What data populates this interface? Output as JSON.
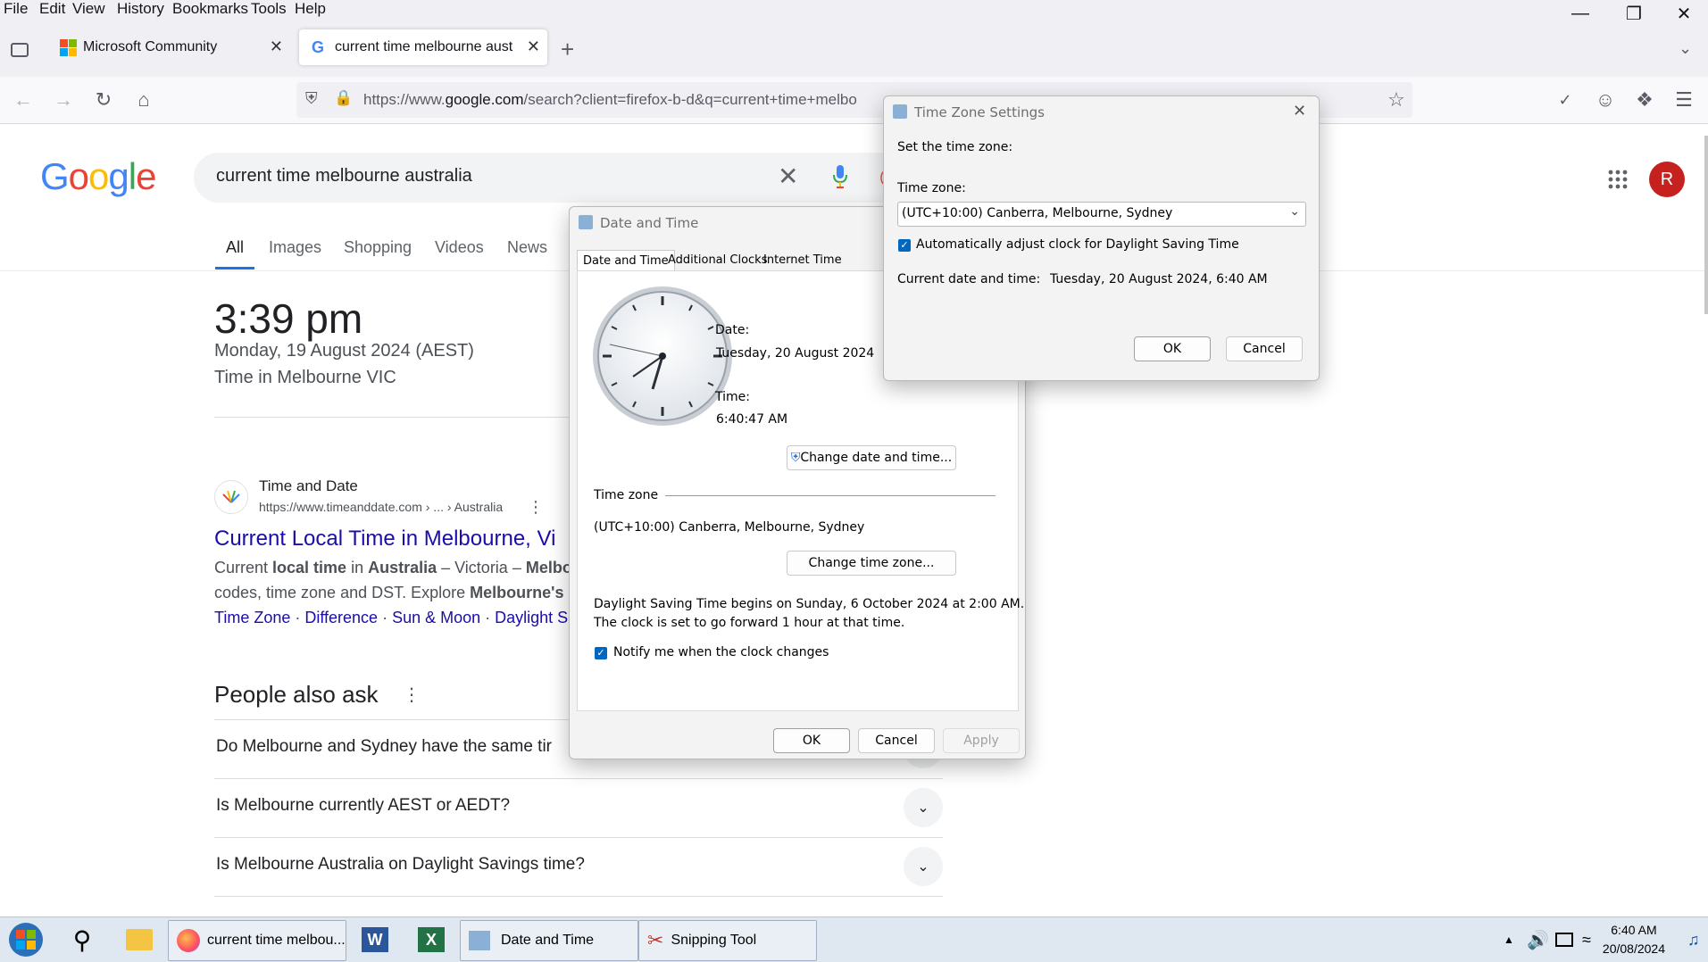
{
  "menubar": {
    "items": [
      "File",
      "Edit",
      "View",
      "History",
      "Bookmarks",
      "Tools",
      "Help"
    ]
  },
  "tabs": [
    {
      "title": "Microsoft Community"
    },
    {
      "title": "current time melbourne australi"
    }
  ],
  "urlbar": {
    "prefix": "https://www.",
    "domain": "google.com",
    "path": "/search?client=firefox-b-d&q=current+time+melbo"
  },
  "google": {
    "logo": "Google",
    "search_query": "current time melbourne australia",
    "tabs": [
      "All",
      "Images",
      "Shopping",
      "Videos",
      "News"
    ],
    "time": "3:39 pm",
    "date": "Monday, 19 August 2024 (AEST)",
    "location": "Time in Melbourne VIC",
    "result": {
      "site_name": "Time and Date",
      "url": "https://www.timeanddate.com › ... › Australia",
      "title": "Current Local Time in Melbourne, Vi",
      "snippet1_a": "Current ",
      "snippet1_b": "local time",
      "snippet1_c": " in ",
      "snippet1_d": "Australia",
      "snippet1_e": " – Victoria – ",
      "snippet1_f": "Melbou",
      "snippet2_a": "codes, time zone and DST. Explore ",
      "snippet2_b": "Melbourne's s",
      "links": [
        "Time Zone",
        "Difference",
        "Sun & Moon",
        "Daylight Sa"
      ]
    },
    "people_also_ask": {
      "title": "People also ask",
      "questions": [
        "Do Melbourne and Sydney have the same tir",
        "Is Melbourne currently AEST or AEDT?",
        "Is Melbourne Australia on Daylight Savings time?"
      ]
    },
    "avatar_letter": "R"
  },
  "date_time_dialog": {
    "title": "Date and Time",
    "tabs": [
      "Date and Time",
      "Additional Clocks",
      "Internet Time"
    ],
    "date_label": "Date:",
    "date_value": "Tuesday, 20 August 2024",
    "time_label": "Time:",
    "time_value": "6:40:47 AM",
    "change_datetime_button": "Change date and time...",
    "timezone_heading": "Time zone",
    "timezone_value": "(UTC+10:00) Canberra, Melbourne, Sydney",
    "change_timezone_button": "Change time zone...",
    "dst_line1": "Daylight Saving Time begins on Sunday, 6 October 2024 at 2:00 AM.",
    "dst_line2": "The clock is set to go forward 1 hour at that time.",
    "notify_label": "Notify me when the clock changes",
    "notify_checked": true,
    "ok": "OK",
    "cancel": "Cancel",
    "apply": "Apply"
  },
  "timezone_dialog": {
    "title": "Time Zone Settings",
    "set_label": "Set the time zone:",
    "tz_label": "Time zone:",
    "tz_selected": "(UTC+10:00) Canberra, Melbourne, Sydney",
    "dst_label": "Automatically adjust clock for Daylight Saving Time",
    "dst_checked": true,
    "current_label": "Current date and time:",
    "current_value": "Tuesday, 20 August 2024, 6:40 AM",
    "ok": "OK",
    "cancel": "Cancel"
  },
  "taskbar": {
    "firefox_label": "current time melbou...",
    "datetime_label": "Date and Time",
    "snipping_label": "Snipping Tool",
    "clock_time": "6:40 AM",
    "clock_date": "20/08/2024"
  },
  "colors": {
    "google_blue": "#4285F4",
    "google_red": "#EA4335",
    "google_yellow": "#FBBC05",
    "google_green": "#34A853",
    "link": "#1a0dab",
    "win_accent": "#0067c0"
  }
}
